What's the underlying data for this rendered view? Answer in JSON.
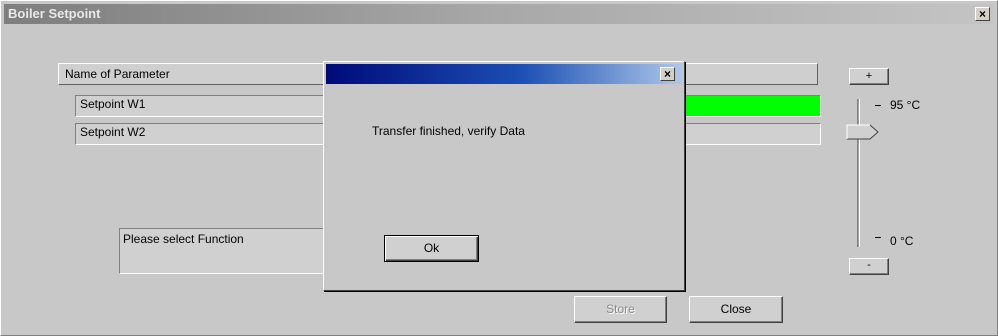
{
  "window": {
    "title": "Boiler Setpoint",
    "close_glyph": "×"
  },
  "table": {
    "header": "Name of Parameter",
    "rows": [
      {
        "name": "Setpoint W1",
        "status_color": "#00ff00"
      },
      {
        "name": "Setpoint W2"
      }
    ]
  },
  "function_box": {
    "text": "Please select Function"
  },
  "slider": {
    "plus_label": "+",
    "minus_label": "-",
    "max_label": "95 °C",
    "min_label": "0 °C",
    "value_fraction": 0.83
  },
  "buttons": {
    "store_label": "Store",
    "close_label": "Close"
  },
  "dialog": {
    "title": "",
    "close_glyph": "×",
    "message": "Transfer finished, verify Data",
    "ok_label": "Ok"
  },
  "colors": {
    "dialog_title_start": "#000a7a",
    "dialog_title_end": "#aec8ea",
    "status_green": "#00ff00"
  }
}
